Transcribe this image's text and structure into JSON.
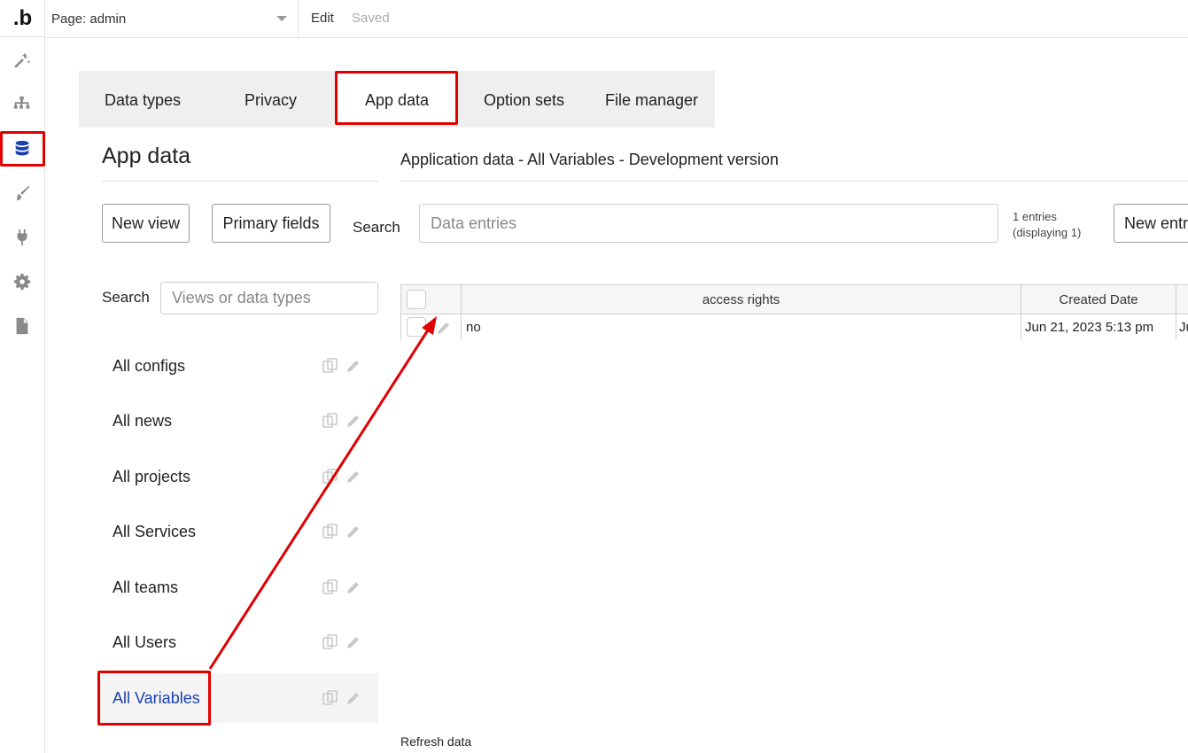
{
  "topbar": {
    "logo": ".b",
    "page_label": "Page: admin",
    "edit_label": "Edit",
    "saved_label": "Saved"
  },
  "rail": {
    "icons": [
      "design-icon",
      "structure-icon",
      "database-icon",
      "brush-icon",
      "plug-icon",
      "gear-icon",
      "document-icon"
    ],
    "active": "database-icon"
  },
  "tabs": [
    {
      "label": "Data types"
    },
    {
      "label": "Privacy"
    },
    {
      "label": "App data",
      "active": true
    },
    {
      "label": "Option sets"
    },
    {
      "label": "File manager"
    }
  ],
  "left_panel": {
    "title": "App data",
    "new_view_label": "New view",
    "primary_fields_label": "Primary fields",
    "search_label": "Search",
    "search_placeholder": "Views or data types",
    "views": [
      {
        "label": "All configs"
      },
      {
        "label": "All news"
      },
      {
        "label": "All projects"
      },
      {
        "label": "All Services"
      },
      {
        "label": "All teams"
      },
      {
        "label": "All Users"
      },
      {
        "label": "All Variables",
        "selected": true
      }
    ]
  },
  "main": {
    "title": "Application data - All Variables - Development version",
    "search_label": "Search",
    "search_placeholder": "Data entries",
    "entries_line1": "1 entries",
    "entries_line2": "(displaying 1)",
    "new_entry_label": "New entr",
    "table": {
      "headers": [
        "access rights",
        "Created Date"
      ],
      "rows": [
        {
          "access_rights": "no",
          "created_date": "Jun 21, 2023 5:13 pm",
          "extra": "Ju"
        }
      ]
    },
    "refresh_label": "Refresh data"
  },
  "colors": {
    "accent": "#1a3fb0",
    "highlight": "#e10000"
  }
}
